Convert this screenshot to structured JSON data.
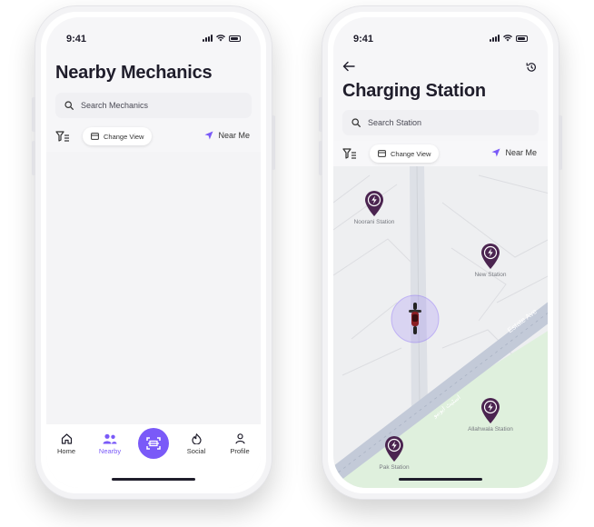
{
  "left_phone": {
    "time": "9:41",
    "title": "Nearby Mechanics",
    "search": {
      "placeholder": "Search Mechanics"
    },
    "toolbar": {
      "change_view": "Change View",
      "near_me": "Near Me"
    },
    "nav": [
      {
        "label": "Home",
        "icon": "home-icon"
      },
      {
        "label": "Nearby",
        "icon": "people-icon",
        "active": true
      },
      {
        "label": "",
        "icon": "scan-icon"
      },
      {
        "label": "Social",
        "icon": "flame-icon"
      },
      {
        "label": "Profile",
        "icon": "user-icon"
      }
    ]
  },
  "right_phone": {
    "time": "9:41",
    "title": "Charging Station",
    "search": {
      "placeholder": "Search Station"
    },
    "toolbar": {
      "change_view": "Change View",
      "near_me": "Near Me"
    },
    "map": {
      "road_label": "Estate Ave",
      "road_label_urdu": "اسٹیٹ ایونیو",
      "stations": [
        {
          "name": "Noorani Station"
        },
        {
          "name": "New Station"
        },
        {
          "name": "Allahwala Station"
        },
        {
          "name": "Pak Station"
        }
      ]
    }
  },
  "colors": {
    "accent": "#7a5af8",
    "pin": "#4b2450",
    "road": "#c3cad8",
    "park": "#dff0dd",
    "map_bg": "#eeeff1"
  }
}
